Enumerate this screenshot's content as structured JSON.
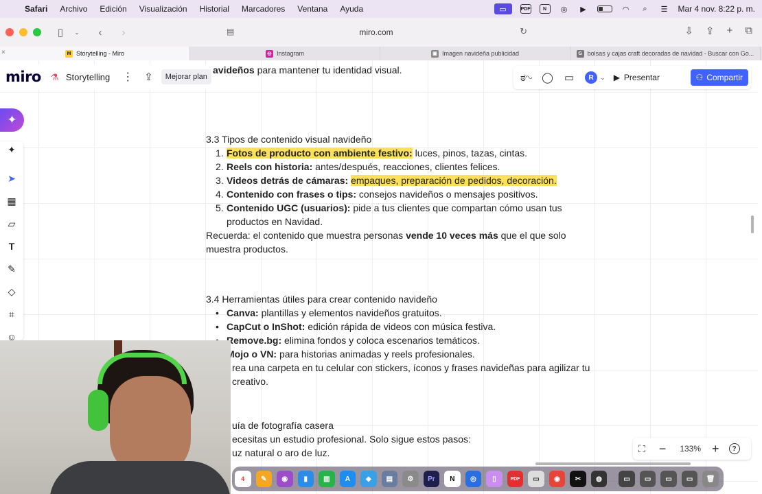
{
  "menubar": {
    "app": "Safari",
    "items": [
      "Archivo",
      "Edición",
      "Visualización",
      "Historial",
      "Marcadores",
      "Ventana",
      "Ayuda"
    ],
    "clock": "Mar 4 nov.  8:22 p. m.",
    "pdf_label": "PDF",
    "notion_label": "N"
  },
  "safari": {
    "url": "miro.com",
    "tabs": [
      {
        "title": "Storytelling - Miro",
        "active": true,
        "icon": "miro-favicon"
      },
      {
        "title": "Instagram",
        "active": false,
        "icon": "instagram-favicon"
      },
      {
        "title": "Imagen navideña publicidad",
        "active": false,
        "icon": "image-favicon"
      },
      {
        "title": "bolsas y cajas craft decoradas de navidad - Buscar con Go...",
        "active": false,
        "icon": "google-favicon"
      }
    ]
  },
  "miro": {
    "logo": "miro",
    "board_name": "Storytelling",
    "upgrade_label": "Mejorar plan",
    "present_label": "Presentar",
    "share_label": "Compartir",
    "avatar_initial": "R",
    "zoom_level": "133%",
    "brand_color": "#4262ff"
  },
  "doc": {
    "top_line_bold": "avideños",
    "top_line_rest": " para mantener tu identidad visual.",
    "s33_heading": "3.3 Tipos de contenido visual navideño",
    "s33_items": [
      {
        "num": "1.",
        "bold": "Fotos de producto con ambiente festivo",
        "colon": ":",
        "rest": " luces, pinos, tazas, cintas."
      },
      {
        "num": "2.",
        "bold": "Reels con historia:",
        "rest": " antes/después, reacciones, clientes felices."
      },
      {
        "num": "3.",
        "bold": "Videos detrás de cámaras:",
        "rest_pre": " ",
        "rest": "empaques, preparación de pedidos, decoración."
      },
      {
        "num": "4.",
        "bold": "Contenido con frases o tips:",
        "rest": " consejos navideños o mensajes positivos."
      },
      {
        "num": "5.",
        "bold": "Contenido UGC (usuarios):",
        "rest": " pide a tus clientes que compartan cómo usan tus",
        "rest2": "productos en Navidad."
      }
    ],
    "reminder_pre": " Recuerda: el contenido que muestra personas ",
    "reminder_bold": "vende 10 veces más",
    "reminder_post": " que el que solo",
    "reminder_line2": "muestra productos.",
    "s34_heading": "3.4 Herramientas útiles para crear contenido navideño",
    "s34_items": [
      {
        "bold": "Canva:",
        "rest": " plantillas y elementos navideños gratuitos."
      },
      {
        "bold": "CapCut o InShot:",
        "rest": " edición rápida de videos con música festiva."
      },
      {
        "bold": "Remove.bg:",
        "rest": " elimina fondos y coloca escenarios temáticos."
      },
      {
        "bold": "Mojo o VN:",
        "rest": " para historias animadas y reels profesionales."
      }
    ],
    "tip_line1": "rea una carpeta en tu celular con stickers, íconos y frases navideñas para agilizar tu",
    "tip_line2": "creativo.",
    "s35_line1": "uía de fotografía casera",
    "s35_line2": "ecesitas un estudio profesional. Solo sigue estos pasos:",
    "s35_line3": "uz natural o aro de luz.",
    "highlight_color": "#fde05a"
  }
}
